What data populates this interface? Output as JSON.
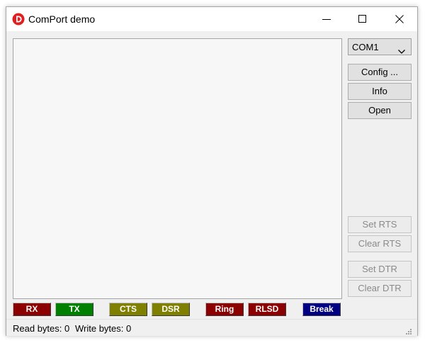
{
  "window": {
    "title": "ComPort demo",
    "app_icon": "delphi-logo-icon",
    "controls": [
      "minimize-icon",
      "maximize-icon",
      "close-icon"
    ]
  },
  "terminal": {
    "content": ""
  },
  "port": {
    "selected": "COM1",
    "icon": "chevron-down-icon"
  },
  "buttons": {
    "config": "Config ...",
    "info": "Info",
    "open": "Open",
    "set_rts": "Set RTS",
    "clear_rts": "Clear RTS",
    "set_dtr": "Set DTR",
    "clear_dtr": "Clear DTR"
  },
  "leds": [
    {
      "label": "RX",
      "color": "#8b0000"
    },
    {
      "label": "TX",
      "color": "#008000"
    },
    {
      "label": "CTS",
      "color": "#808000"
    },
    {
      "label": "DSR",
      "color": "#808000"
    },
    {
      "label": "Ring",
      "color": "#8b0000"
    },
    {
      "label": "RLSD",
      "color": "#8b0000"
    },
    {
      "label": "Break",
      "color": "#000080"
    }
  ],
  "status": {
    "read": "Read bytes: 0",
    "write": "Write bytes: 0"
  }
}
